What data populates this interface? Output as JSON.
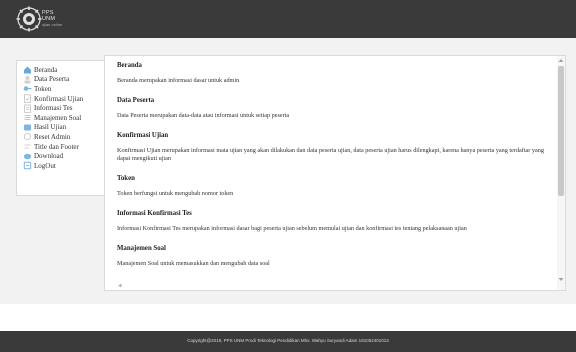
{
  "brand": {
    "title": "PPS",
    "subtitle": "UNM",
    "tagline": "ujian online"
  },
  "sidebar": {
    "items": [
      {
        "label": "Beranda",
        "icon": "home-icon",
        "color": "#6aa8d8"
      },
      {
        "label": "Data Peserta",
        "icon": "users-icon",
        "color": "#d0d0d0"
      },
      {
        "label": "Token",
        "icon": "key-icon",
        "color": "#7fb6e0"
      },
      {
        "label": "Konfirmasi Ujian",
        "icon": "check-doc-icon",
        "color": "#c8c8c8"
      },
      {
        "label": "Informasi Tes",
        "icon": "info-icon",
        "color": "#c8c8c8"
      },
      {
        "label": "Manajemen Soal",
        "icon": "list-icon",
        "color": "#c8c8c8"
      },
      {
        "label": "Hasil Ujian",
        "icon": "chart-icon",
        "color": "#7fb6e0"
      },
      {
        "label": "Reset Admin",
        "icon": "refresh-icon",
        "color": "#c8c8c8"
      },
      {
        "label": "Title dan Footer",
        "icon": "text-icon",
        "color": "#c8c8c8"
      },
      {
        "label": "Download",
        "icon": "download-icon",
        "color": "#7fb6e0"
      },
      {
        "label": "LogOut",
        "icon": "logout-icon",
        "color": "#7fb6e0"
      }
    ]
  },
  "main": {
    "sections": [
      {
        "title": "Beranda",
        "text": "Beranda merupakan informasi dasar untuk admin"
      },
      {
        "title": "Data Peserta",
        "text": "Data Peserta merupakan data-data atau informasi untuk setiap peserta"
      },
      {
        "title": "Konfirmasi Ujian",
        "text": "Konfirmasi Ujian merupakan informasi mata ujian yang akan dilakukan dan data peserta ujian, data peserta ujian harus dilengkapi, karena hanya peserta yang terdaftar yang dapat mengikuti ujian"
      },
      {
        "title": "Token",
        "text": "Token berfungsi untuk mengubah nomor token"
      },
      {
        "title": "Informasi Konfirmasi Tes",
        "text": "Informasi Konfirmasi Tes merupakan informasi dasar bagi peserta ujian sebelum memulai ujian dan konfirmasi tes tentang pelaksanaan ujian"
      },
      {
        "title": "Manajemen Soal",
        "text": "Manajemen Soal untuk memasukkan dan mengubah data soal"
      }
    ]
  },
  "footer": {
    "text": "Copyright@2019, PPS UNM Prodi Teknologi Pendidikan Mhs. Wahyu Suryandi Adam 181052401013"
  },
  "colors": {
    "topbar": "#3a3a3a",
    "background": "#f2f2f2",
    "accent": "#6aa8d8"
  }
}
